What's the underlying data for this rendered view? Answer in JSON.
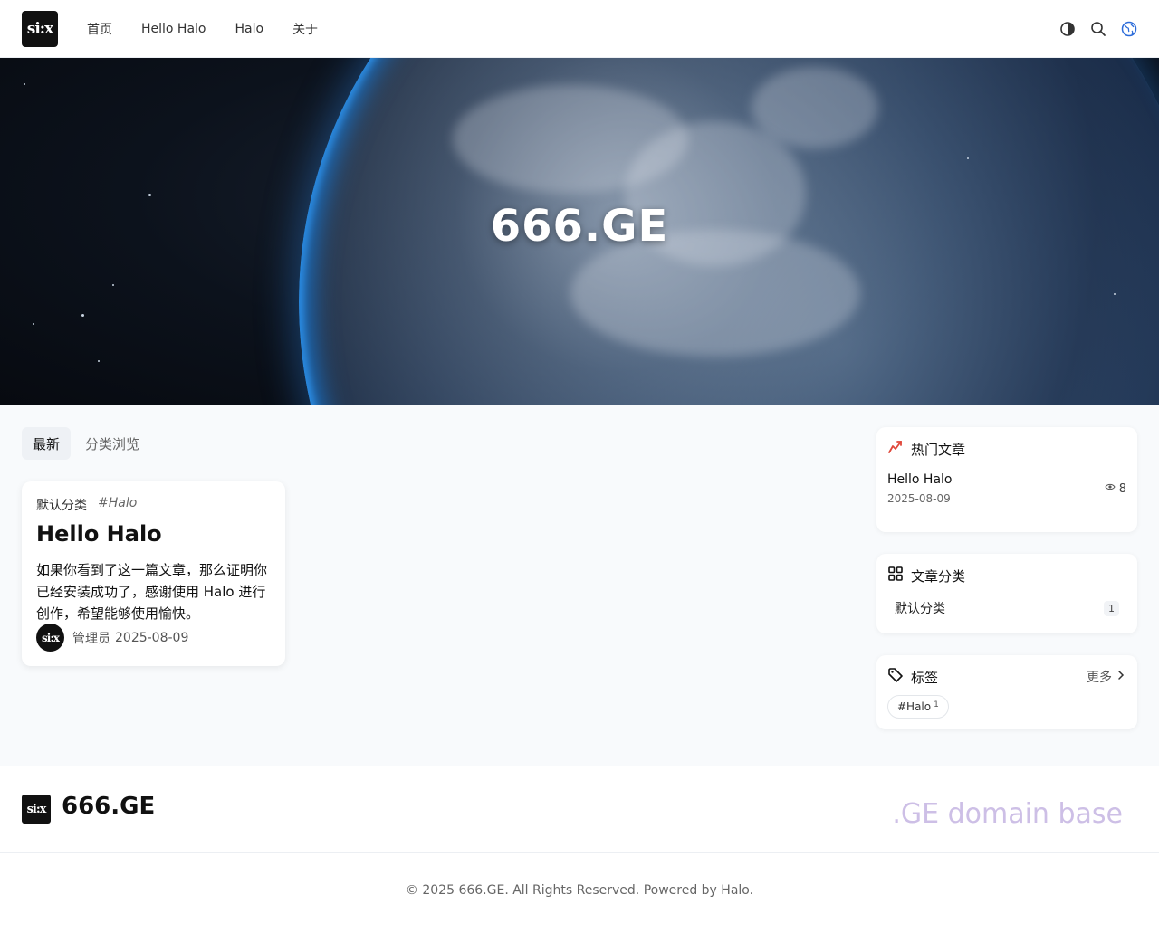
{
  "header": {
    "logo_text": "si:x",
    "nav": [
      {
        "label": "首页"
      },
      {
        "label": "Hello Halo"
      },
      {
        "label": "Halo"
      },
      {
        "label": "关于"
      }
    ],
    "icons": [
      "theme-toggle-icon",
      "search-icon",
      "globe-icon"
    ]
  },
  "hero": {
    "title": "666.GE"
  },
  "main": {
    "tabs": [
      {
        "label": "最新",
        "active": true
      },
      {
        "label": "分类浏览",
        "active": false
      }
    ],
    "post": {
      "category": "默认分类",
      "tag": "#Halo",
      "title": "Hello Halo",
      "excerpt": "如果你看到了这一篇文章，那么证明你已经安装成功了，感谢使用 Halo 进行创作，希望能够使用愉快。",
      "avatar_text": "si:x",
      "author": "管理员",
      "date": "2025-08-09"
    }
  },
  "sidebar": {
    "hot": {
      "title": "热门文章",
      "post_title": "Hello Halo",
      "post_date": "2025-08-09",
      "views": "8"
    },
    "categories": {
      "title": "文章分类",
      "items": [
        {
          "name": "默认分类",
          "count": "1"
        }
      ]
    },
    "tags": {
      "title": "标签",
      "more_label": "更多",
      "items": [
        {
          "name": "#Halo",
          "count": "1"
        }
      ]
    }
  },
  "footer": {
    "logo_text": "si:x",
    "site_name": "666.GE",
    "slogan": ".GE domain base",
    "copyright": "© 2025 666.GE. All Rights Reserved. Powered by Halo."
  },
  "colors": {
    "accent_hot": "#e0473a",
    "slogan": "#cdbfe6",
    "planet_glow": "#1a7bd8"
  }
}
